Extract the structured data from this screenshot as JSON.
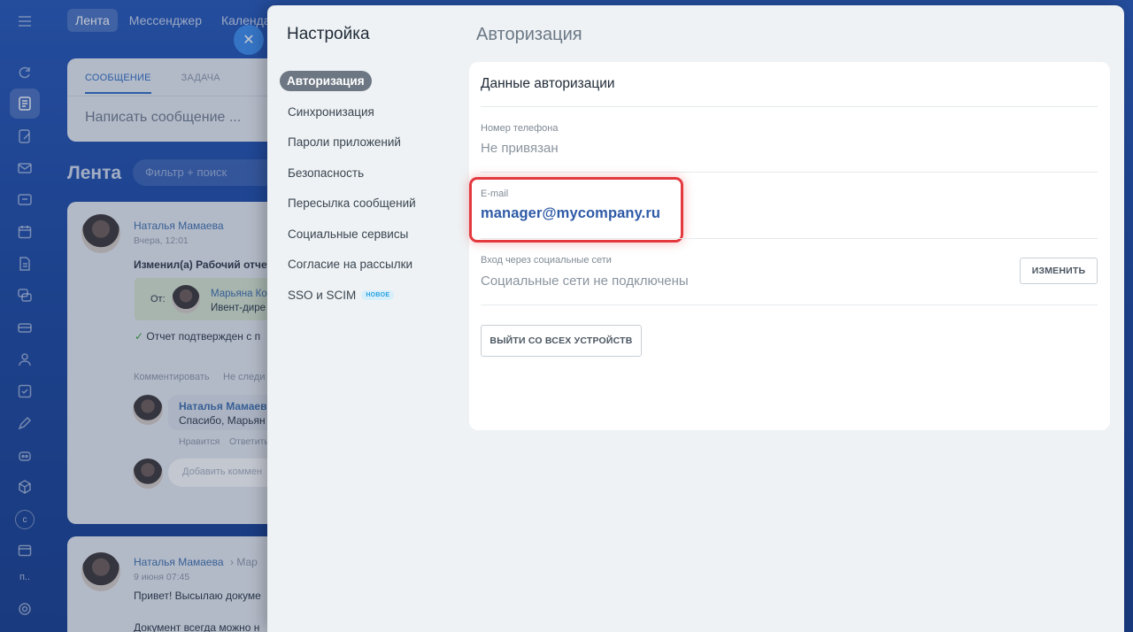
{
  "background": {
    "topnav": [
      "Лента",
      "Мессенджер",
      "Календарь"
    ],
    "rail_text": [
      "с",
      "п.."
    ],
    "composer": {
      "tabs": [
        "СООБЩЕНИЕ",
        "ЗАДАЧА"
      ],
      "placeholder": "Написать сообщение ..."
    },
    "feed_title": "Лента",
    "feed_filter": "Фильтр + поиск",
    "post1": {
      "author": "Наталья Мамаева",
      "date": "Вчера, 12:01",
      "text": "Изменил(а) Рабочий отчет з",
      "from_label": "От:",
      "approver_name": "Марьяна Ко",
      "approver_role": "Ивент-дире",
      "confirmed": "Отчет подтвержден с п",
      "actions": [
        "Комментировать",
        "Не следи"
      ],
      "reply_author": "Наталья Мамаев",
      "reply_text": "Спасибо, Марьян",
      "reply_actions": [
        "Нравится",
        "Ответить"
      ],
      "comment_placeholder": "Добавить коммен"
    },
    "post2": {
      "author": "Наталья Мамаева",
      "recipient": "Мар",
      "date": "9 июня 07:45",
      "text": "Привет! Высылаю докуме",
      "text2": "Документ всегда можно н"
    }
  },
  "settings": {
    "title": "Настройка",
    "nav": [
      {
        "label": "Авторизация",
        "active": true
      },
      {
        "label": "Синхронизация"
      },
      {
        "label": "Пароли приложений"
      },
      {
        "label": "Безопасность"
      },
      {
        "label": "Пересылка сообщений"
      },
      {
        "label": "Социальные сервисы"
      },
      {
        "label": "Согласие на рассылки"
      },
      {
        "label": "SSO и SCIM",
        "badge": "НОВОЕ"
      }
    ],
    "section_title": "Авторизация",
    "card": {
      "title": "Данные авторизации",
      "phone_label": "Номер телефона",
      "phone_value": "Не привязан",
      "email_label": "E-mail",
      "email_value": "manager@mycompany.ru",
      "social_label": "Вход через социальные сети",
      "social_value": "Социальные сети не подключены",
      "change_button": "ИЗМЕНИТЬ",
      "logout_button": "ВЫЙТИ СО ВСЕХ УСТРОЙСТВ"
    },
    "highlight_color": "#e4383f"
  }
}
